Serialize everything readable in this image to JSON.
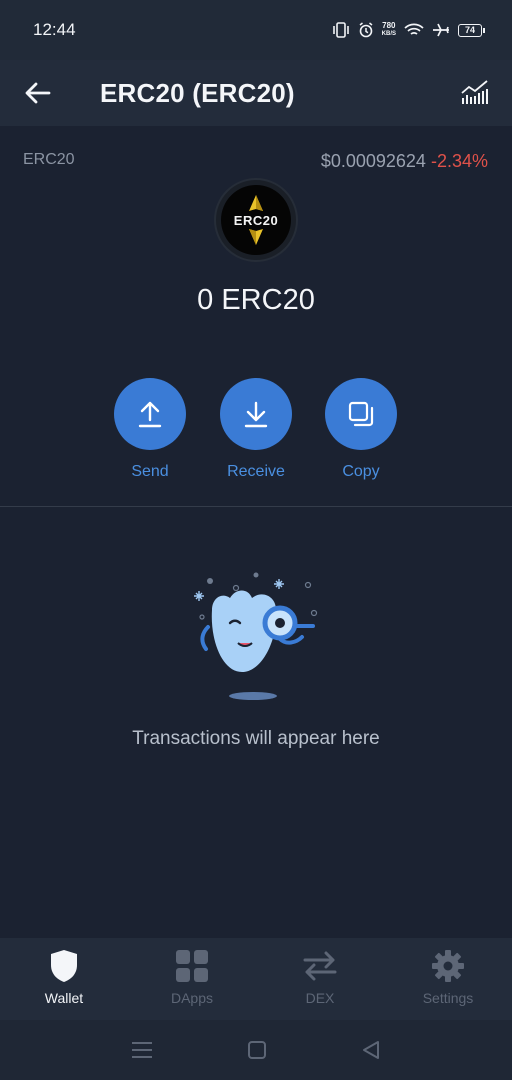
{
  "status_bar": {
    "time": "12:44",
    "net_speed_value": "780",
    "net_speed_unit": "KB/S",
    "battery": "74"
  },
  "app_bar": {
    "title": "ERC20 (ERC20)"
  },
  "coin": {
    "symbol": "ERC20",
    "price": "$0.00092624",
    "change": "-2.34%",
    "logo_text": "ERC20",
    "balance": "0 ERC20"
  },
  "actions": [
    {
      "label": "Send",
      "icon": "upload-arrow-icon"
    },
    {
      "label": "Receive",
      "icon": "download-arrow-icon"
    },
    {
      "label": "Copy",
      "icon": "copy-icon"
    }
  ],
  "empty_state": {
    "text": "Transactions will appear here"
  },
  "tabs": [
    {
      "label": "Wallet",
      "icon": "shield-icon",
      "active": true
    },
    {
      "label": "DApps",
      "icon": "grid-icon",
      "active": false
    },
    {
      "label": "DEX",
      "icon": "swap-arrows-icon",
      "active": false
    },
    {
      "label": "Settings",
      "icon": "gear-icon",
      "active": false
    }
  ],
  "colors": {
    "background": "#1b2231",
    "accent": "#3a7bd5",
    "negative": "#e0524a"
  }
}
